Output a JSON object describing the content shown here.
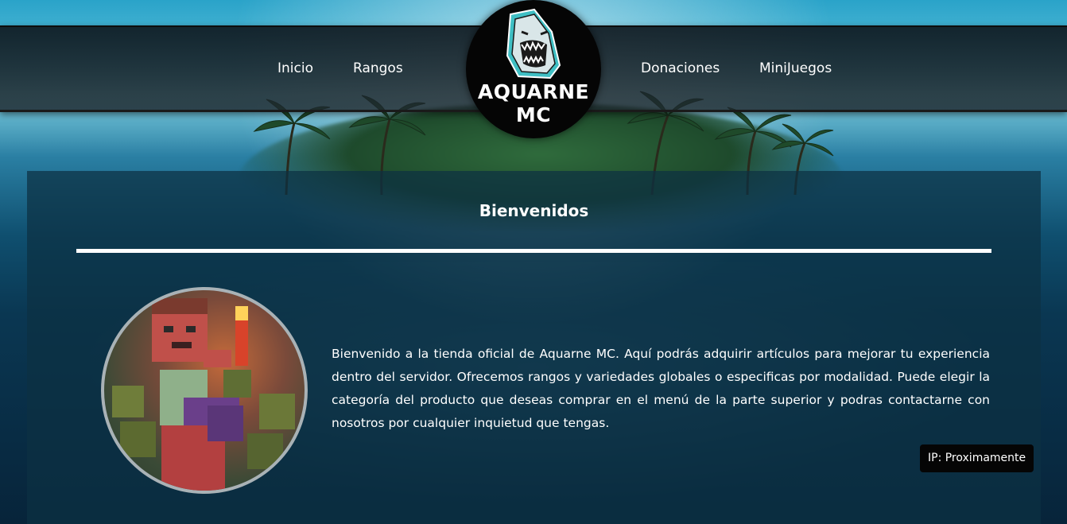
{
  "nav": {
    "left_links": [
      "Inicio",
      "Rangos"
    ],
    "right_links": [
      "Donaciones",
      "MiniJuegos"
    ]
  },
  "logo": {
    "text": "AQUARNE MC",
    "icon": "shark-icon"
  },
  "panel": {
    "title": "Bienvenidos",
    "description": "Bienvenido a la tienda oficial de Aquarne MC. Aquí podrás adquirir artículos para mejorar tu experiencia dentro del servidor. Ofrecemos rangos y variedades globales o especificas por modalidad. Puede elegir la categoría del producto que deseas comprar en el menú de la parte superior y podras contactarne con nosotros por cualquier inquietud que tengas.",
    "avatar_icon": "minecraft-character-avatar"
  },
  "ip_badge": "IP: Proximamente",
  "colors": {
    "panel_bg": "#0c3042",
    "text": "#ffffff",
    "badge_bg": "#050505",
    "logo_accent": "#3fbfc4"
  }
}
